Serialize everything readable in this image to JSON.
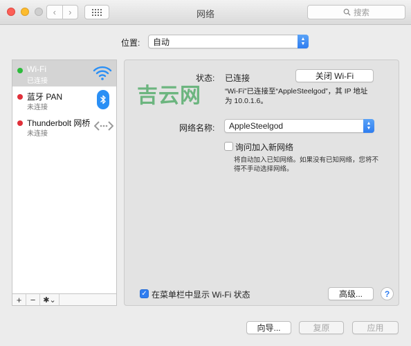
{
  "window": {
    "title": "网络"
  },
  "toolbar": {
    "back_glyph": "‹",
    "forward_glyph": "›",
    "search_placeholder": "搜索"
  },
  "location": {
    "label": "位置:",
    "value": "自动"
  },
  "services": [
    {
      "name": "Wi-Fi",
      "status": "已连接",
      "status_color": "#2dbb3c",
      "selected": true,
      "icon": "wifi-icon"
    },
    {
      "name": "蓝牙 PAN",
      "status": "未连接",
      "status_color": "#e0303a",
      "icon": "bluetooth-icon"
    },
    {
      "name": "Thunderbolt 网桥",
      "status": "未连接",
      "status_color": "#e0303a",
      "icon": "thunderbolt-bridge-icon"
    }
  ],
  "sidebar_tools": {
    "add": "+",
    "remove": "−",
    "gear": "✱⌄"
  },
  "detail": {
    "status_label": "状态:",
    "status_value": "已连接",
    "toggle_wifi_label": "关闭 Wi-Fi",
    "status_desc_line1": "“Wi-Fi”已连接至“AppleSteelgod”，其 IP 地址",
    "status_desc_line2": "为 10.0.1.6。",
    "network_name_label": "网络名称:",
    "network_name_value": "AppleSteelgod",
    "ask_join_label": "询问加入新网络",
    "ask_join_checked": false,
    "ask_join_desc_line1": "将自动加入已知网络。如果没有已知网络，您将不",
    "ask_join_desc_line2": "得不手动选择网络。",
    "show_menubar_label": "在菜单栏中显示 Wi-Fi 状态",
    "show_menubar_checked": true,
    "advanced_label": "高级...",
    "help_label": "?"
  },
  "watermark": "吉云网",
  "footer": {
    "assist_label": "向导...",
    "revert_label": "复原",
    "apply_label": "应用"
  },
  "colors": {
    "accent": "#2f7df0",
    "connected": "#2dbb3c",
    "disconnected": "#e0303a"
  }
}
